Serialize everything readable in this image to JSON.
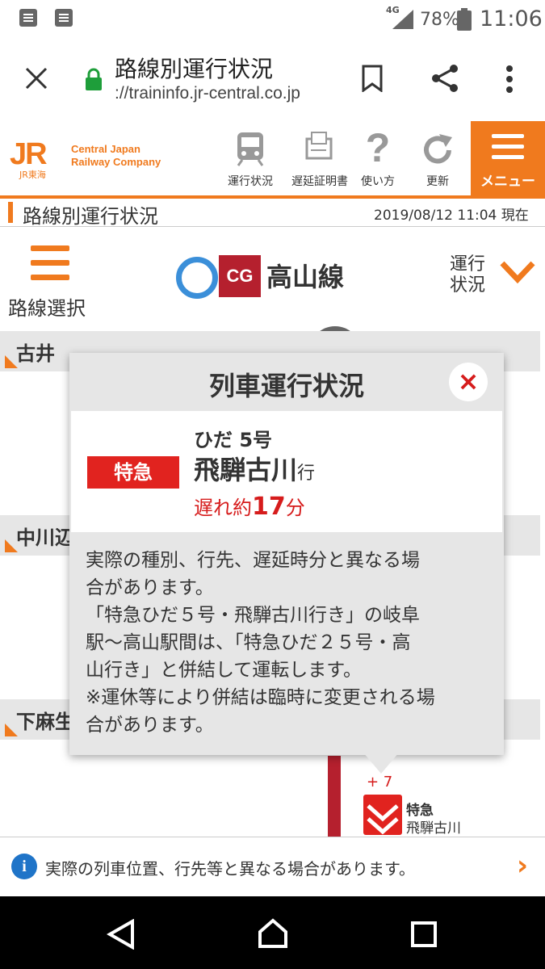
{
  "status_bar": {
    "network": "4G",
    "battery": "78%",
    "time": "11:06"
  },
  "browser": {
    "title": "路線別運行状況",
    "url": "://traininfo.jr-central.co.jp"
  },
  "site_header": {
    "logo": "JR",
    "logo_sub": "JR東海",
    "company_line1": "Central Japan",
    "company_line2": "Railway Company",
    "nav": [
      {
        "label": "運行状況",
        "icon": "train-icon"
      },
      {
        "label": "遅延証明書",
        "icon": "certificate-icon"
      },
      {
        "label": "使い方",
        "icon": "question-icon"
      },
      {
        "label": "更新",
        "icon": "refresh-icon"
      }
    ],
    "menu_label": "メニュー"
  },
  "page": {
    "title": "路線別運行状況",
    "timestamp": "2019/08/12 11:04 現在"
  },
  "line_header": {
    "line_select_label": "路線選択",
    "line_code": "CG",
    "line_name": "高山線",
    "status_toggle_line1": "運行",
    "status_toggle_line2": "状況"
  },
  "stations": [
    {
      "name": "古井"
    },
    {
      "name": "中川辺"
    },
    {
      "name": "下麻生"
    }
  ],
  "train_marker": {
    "delay": "+ 7",
    "type": "特急",
    "destination": "飛騨古川"
  },
  "popup": {
    "title": "列車運行状況",
    "close": "×",
    "train_type": "特急",
    "train_name": "ひだ 5号",
    "destination": "飛騨古川",
    "destination_suffix": "行",
    "delay_prefix": "遅れ約",
    "delay_minutes": "17",
    "delay_suffix": "分",
    "message_lines": [
      "実際の種別、行先、遅延時分と異なる場",
      "合があります。",
      "「特急ひだ５号・飛騨古川行き」の岐阜",
      "駅～高山駅間は、「特急ひだ２５号・高",
      "山行き」と併結して運転します。",
      "※運休等により併結は臨時に変更される場",
      "合があります。"
    ]
  },
  "notice": {
    "text": "実際の列車位置、行先等と異なる場合があります。"
  },
  "colors": {
    "accent": "#f07a1e",
    "line": "#b5202e",
    "alert": "#e1231f",
    "info": "#1f74c8"
  }
}
